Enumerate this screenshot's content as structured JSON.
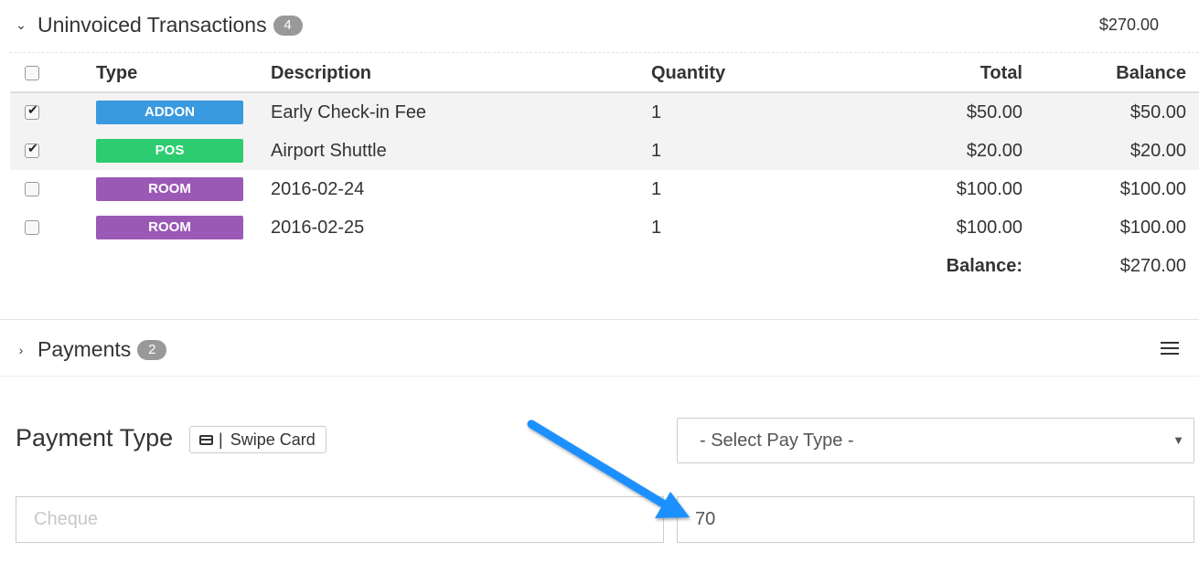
{
  "uninvoiced": {
    "title": "Uninvoiced Transactions",
    "count": "4",
    "total": "$270.00",
    "columns": {
      "type": "Type",
      "description": "Description",
      "quantity": "Quantity",
      "total": "Total",
      "balance": "Balance"
    },
    "rows": [
      {
        "checked": true,
        "type": "ADDON",
        "type_color": "#3a9ae0",
        "description": "Early Check-in Fee",
        "quantity": "1",
        "total": "$50.00",
        "balance": "$50.00"
      },
      {
        "checked": true,
        "type": "POS",
        "type_color": "#2ecc71",
        "description": "Airport Shuttle",
        "quantity": "1",
        "total": "$20.00",
        "balance": "$20.00"
      },
      {
        "checked": false,
        "type": "ROOM",
        "type_color": "#9b59b6",
        "description": "2016-02-24",
        "quantity": "1",
        "total": "$100.00",
        "balance": "$100.00"
      },
      {
        "checked": false,
        "type": "ROOM",
        "type_color": "#9b59b6",
        "description": "2016-02-25",
        "quantity": "1",
        "total": "$100.00",
        "balance": "$100.00"
      }
    ],
    "balance_label": "Balance:",
    "balance_value": "$270.00"
  },
  "payments": {
    "title": "Payments",
    "count": "2",
    "menu_icon": "hamburger-menu-icon"
  },
  "payment_form": {
    "label": "Payment Type",
    "swipe_label": "Swipe Card",
    "swipe_icon": "credit-card-icon",
    "select_placeholder": "- Select Pay Type -",
    "cheque_placeholder": "Cheque",
    "amount_value": "70"
  },
  "annotation_arrow_color": "#1e90ff"
}
